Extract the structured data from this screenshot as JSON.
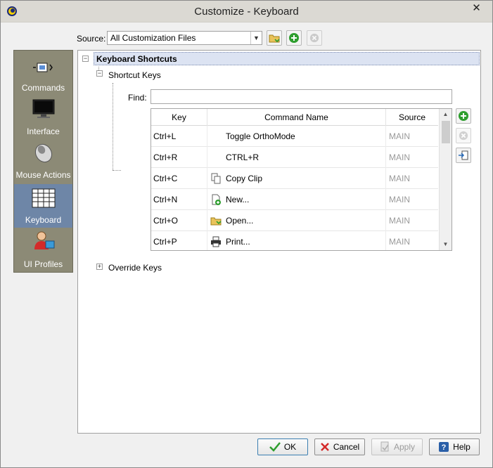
{
  "window": {
    "title": "Customize - Keyboard",
    "close_glyph": "✕"
  },
  "source": {
    "label": "Source:",
    "selected": "All Customization Files"
  },
  "nav": {
    "items": [
      {
        "label": "Commands",
        "icon": "commands-icon"
      },
      {
        "label": "Interface",
        "icon": "monitor-icon"
      },
      {
        "label": "Mouse Actions",
        "icon": "mouse-icon"
      },
      {
        "label": "Keyboard",
        "icon": "keyboard-icon",
        "selected": true
      },
      {
        "label": "UI Profiles",
        "icon": "user-profile-icon"
      }
    ]
  },
  "tree": {
    "root": "Keyboard Shortcuts",
    "shortcut_keys": "Shortcut Keys",
    "override_keys": "Override Keys",
    "toggle_minus": "−",
    "toggle_plus": "+"
  },
  "find": {
    "label": "Find:",
    "value": ""
  },
  "grid": {
    "columns": [
      "Key",
      "Command Name",
      "Source"
    ],
    "rows": [
      {
        "key": "Ctrl+L",
        "command": "Toggle OrthoMode",
        "source": "MAIN",
        "icon": ""
      },
      {
        "key": "Ctrl+R",
        "command": "CTRL+R",
        "source": "MAIN",
        "icon": ""
      },
      {
        "key": "Ctrl+C",
        "command": "Copy Clip",
        "source": "MAIN",
        "icon": "copy-icon"
      },
      {
        "key": "Ctrl+N",
        "command": "New...",
        "source": "MAIN",
        "icon": "new-file-icon"
      },
      {
        "key": "Ctrl+O",
        "command": "Open...",
        "source": "MAIN",
        "icon": "open-folder-icon"
      },
      {
        "key": "Ctrl+P",
        "command": "Print...",
        "source": "MAIN",
        "icon": "printer-icon"
      }
    ]
  },
  "buttons": {
    "ok": "OK",
    "cancel": "Cancel",
    "apply": "Apply",
    "help": "Help"
  },
  "colors": {
    "nav_bg": "#8c8a76",
    "nav_selected": "#6e86a7",
    "header_bg": "#dce3f2",
    "add_green": "#2e9e2e"
  }
}
